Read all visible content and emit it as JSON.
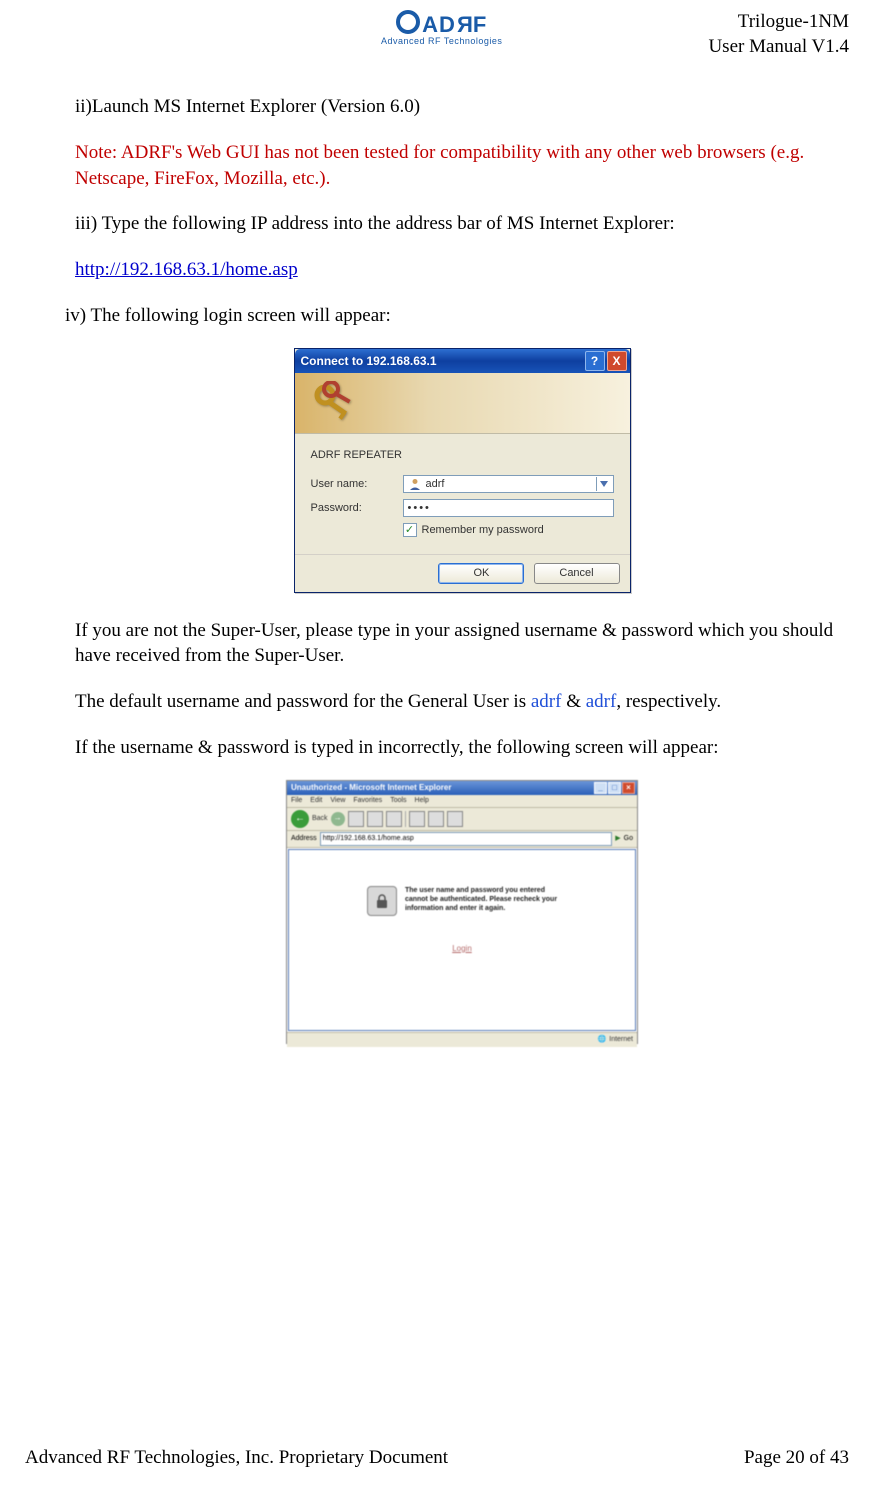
{
  "header": {
    "logo_text": "ADRF",
    "logo_sub": "Advanced RF Technologies",
    "doc_title_1": "Trilogue-1NM",
    "doc_title_2": "User Manual V1.4"
  },
  "body": {
    "p1": "ii)Launch MS Internet Explorer (Version 6.0)",
    "p2": "Note: ADRF's Web GUI has not been tested for compatibility with any other web browsers (e.g. Netscape, FireFox, Mozilla, etc.).",
    "p3": "iii) Type the following IP address into the address bar of MS Internet Explorer:",
    "p4_link": "http://192.168.63.1/home.asp",
    "p5": "iv) The following login screen will appear:",
    "p6": "If you are not the Super-User, please type in your assigned username & password which you should have received from the Super-User.",
    "p7a": "The default username and password for the General User is ",
    "p7_user": "adrf",
    "p7b": " & ",
    "p7_pass": "adrf",
    "p7c": ", respectively.",
    "p8": "If the username & password is typed in incorrectly, the following screen will appear:"
  },
  "dialog": {
    "title": "Connect to 192.168.63.1",
    "server": "ADRF REPEATER",
    "user_label": "User name:",
    "user_value": "adrf",
    "pass_label": "Password:",
    "pass_value": "••••",
    "remember": "Remember my password",
    "ok": "OK",
    "cancel": "Cancel"
  },
  "browser": {
    "title": "Unauthorized - Microsoft Internet Explorer",
    "menu": [
      "File",
      "Edit",
      "View",
      "Favorites",
      "Tools",
      "Help"
    ],
    "address_label": "Address",
    "address_value": "http://192.168.63.1/home.asp",
    "go": "Go",
    "error_l1": "The user name and password you entered",
    "error_l2": "cannot be authenticated. Please recheck your",
    "error_l3": "information and enter it again.",
    "login_link": "Login",
    "status": "Internet"
  },
  "footer": {
    "left": "Advanced RF Technologies, Inc. Proprietary Document",
    "right": "Page 20 of 43"
  }
}
